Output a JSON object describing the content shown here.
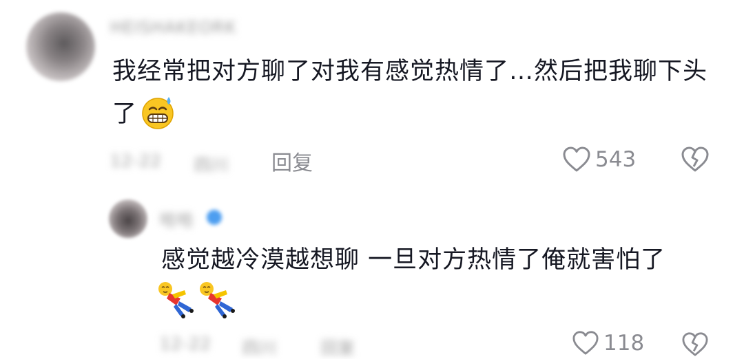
{
  "comment": {
    "username": "HEISHAKEORK",
    "text": "我经常把对方聊了对我有感觉热情了…然后把我聊下头了",
    "meta_date": "12-22",
    "meta_location": "四川",
    "reply_label": "回复",
    "like_count": "543",
    "emoji": "grinning-sweat-emoji"
  },
  "reply": {
    "username": "哈哈",
    "text": "感觉越冷漠越想聊 一旦对方热情了俺就害怕了",
    "meta_date": "12-22",
    "meta_location": "四川",
    "meta_extra": "回复",
    "like_count": "118",
    "emoji": "falling-figure-emoji"
  },
  "colors": {
    "text_primary": "#161823",
    "text_secondary": "#8a8b91",
    "background": "#ffffff"
  }
}
